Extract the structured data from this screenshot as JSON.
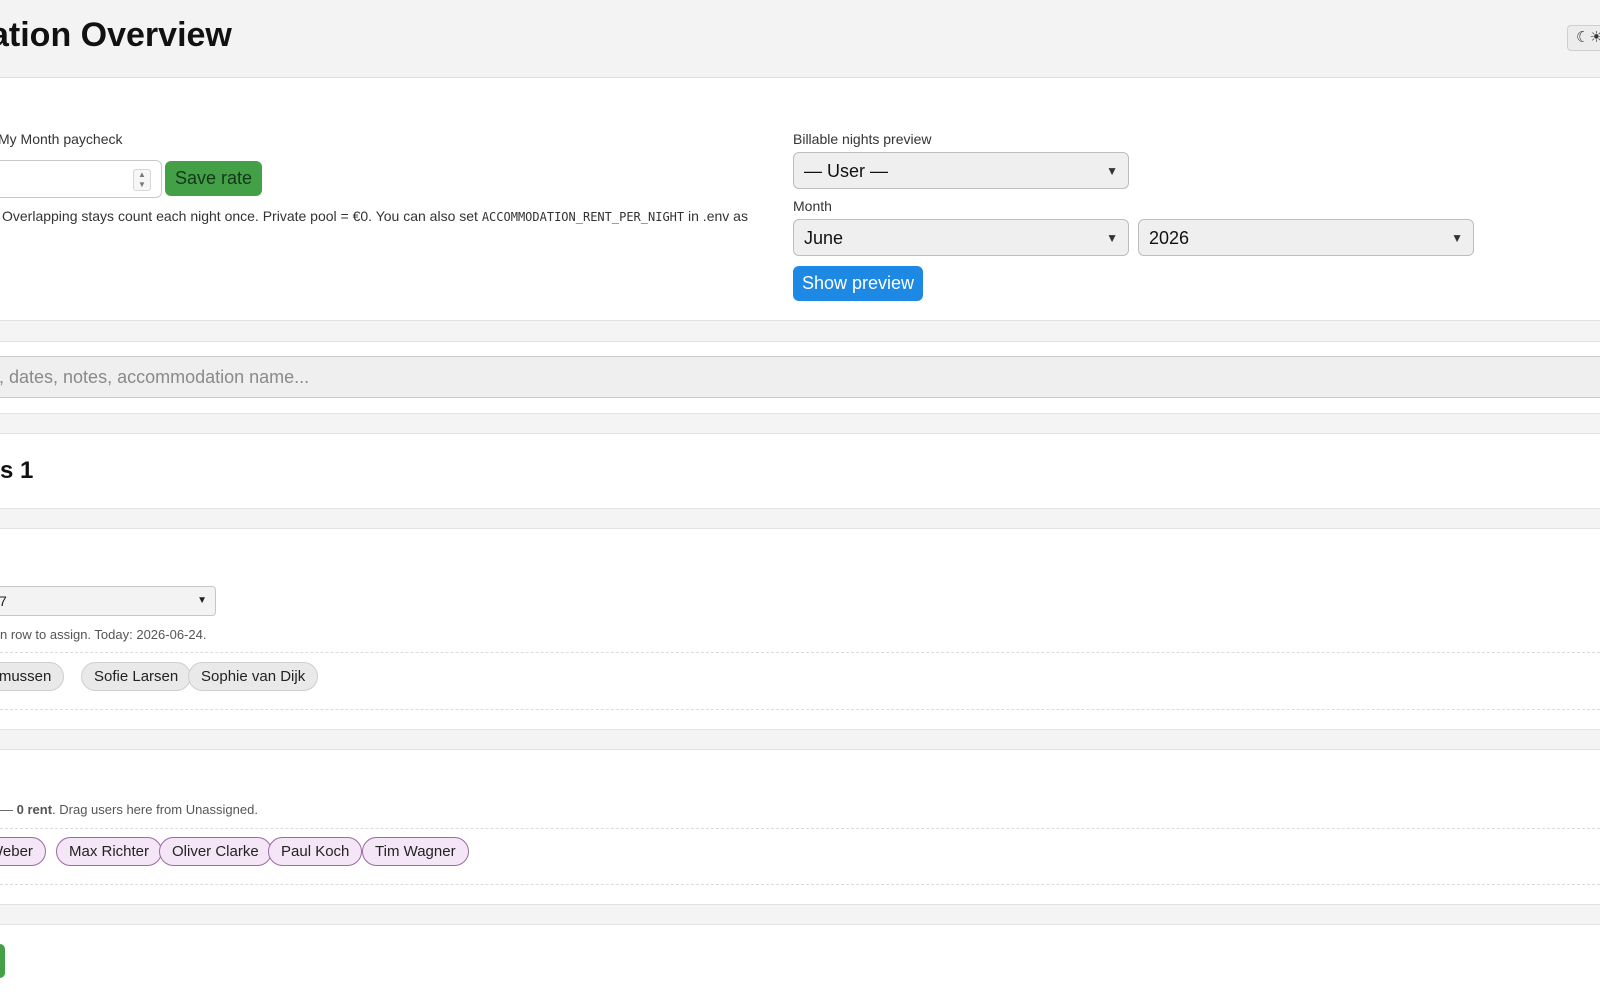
{
  "header": {
    "title": "ation Overview",
    "theme_toggle_label": "☾☀"
  },
  "rate": {
    "label": "My Month paycheck",
    "value": "",
    "save_label": "Save rate",
    "note_prefix": "Overlapping stays count each night once. Private pool = €0. You can also set ",
    "note_code": "ACCOMMODATION_RENT_PER_NIGHT",
    "note_suffix": " in .env as"
  },
  "preview": {
    "label": "Billable nights preview",
    "user_select": "— User —",
    "month_label": "Month",
    "month_select": "June",
    "year_select": "2026",
    "show_label": "Show preview"
  },
  "search": {
    "placeholder": ", dates, notes, accommodation name..."
  },
  "section1": {
    "title": "s 1",
    "select_value": "7",
    "hint": "n row to assign. Today: 2026-06-24.",
    "chips": [
      "asmussen",
      "Sofie Larsen",
      "Sophie van Dijk"
    ]
  },
  "section2": {
    "hint_prefix": "— ",
    "hint_bold": "0 rent",
    "hint_suffix": ". Drag users here from Unassigned.",
    "chips": [
      "Weber",
      "Max Richter",
      "Oliver Clarke",
      "Paul Koch",
      "Tim Wagner"
    ]
  }
}
